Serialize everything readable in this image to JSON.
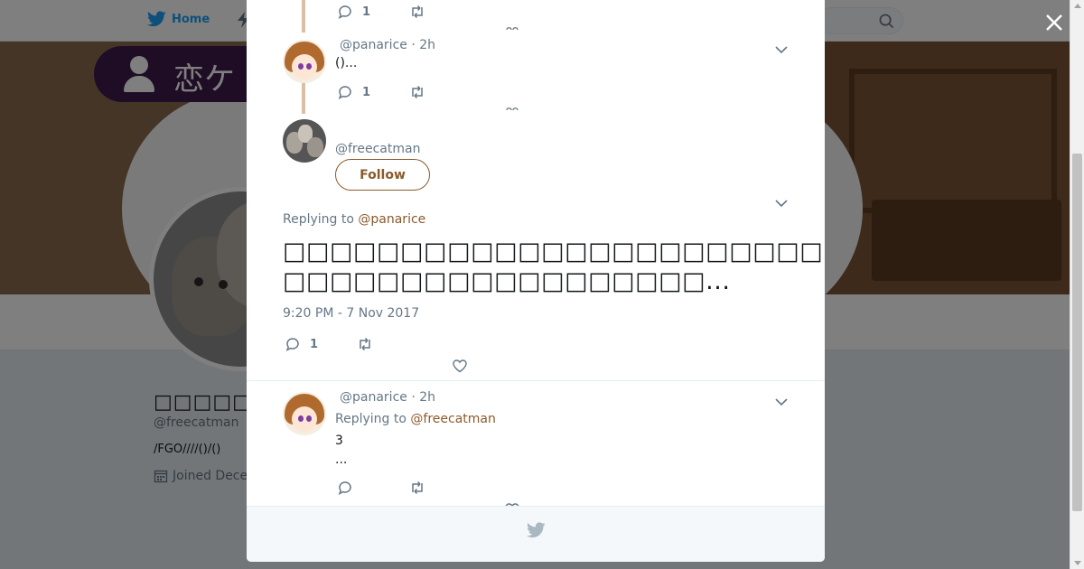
{
  "background": {
    "nav": {
      "home_label": "Home"
    },
    "banner": {
      "tag_text": "恋ケ"
    },
    "profile": {
      "name": "□□□□□□□",
      "handle": "@freecatman",
      "bio": "/FGO////()/()",
      "joined": "Joined Dece"
    }
  },
  "colors": {
    "accent": "#8a5a2b",
    "twitter_blue": "#1da1f2",
    "thread_line": "#d9bfa6",
    "secondary_text": "#657786"
  },
  "modal": {
    "tweets": [
      {
        "position": "top-partial",
        "reply_count": "1"
      },
      {
        "handle": "@panarice",
        "separator": "·",
        "time": "2h",
        "text": "()...",
        "reply_count": "1"
      }
    ],
    "main_tweet": {
      "handle": "@freecatman",
      "follow_label": "Follow",
      "replying_to_label": "Replying to",
      "replying_to_user": "@panarice",
      "text_line1": "□□□□□□□□□□□□□□□□□□□□□□□□□",
      "text_line2": "□□□□□□□□□□□□□□□□□□...",
      "timestamp": "9:20 PM - 7 Nov 2017",
      "reply_count": "1"
    },
    "reply": {
      "handle": "@panarice",
      "separator": "·",
      "time": "2h",
      "replying_to_label": "Replying to",
      "replying_to_user": "@freecatman",
      "text_line1": "3",
      "text_line2": "..."
    }
  },
  "icons": [
    "twitter-bird-icon",
    "moments-icon",
    "search-icon",
    "close-icon",
    "reply-icon",
    "retweet-icon",
    "like-icon",
    "chevron-down-icon",
    "calendar-icon"
  ]
}
